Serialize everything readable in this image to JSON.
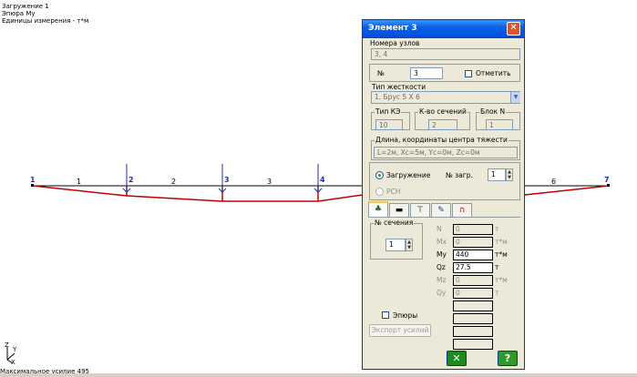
{
  "info": {
    "line1": "Загружение  1",
    "line2": "Эпюра My",
    "line3": "Единицы измерения - т*м"
  },
  "footer": {
    "max_force": "Максимальное усилие  495"
  },
  "axes": {
    "z": "Z",
    "y": "Y",
    "x": "X"
  },
  "model": {
    "node_labels": [
      "1",
      "2",
      "3",
      "4",
      "7"
    ],
    "element_labels": [
      "1",
      "2",
      "3",
      "6"
    ]
  },
  "dialog": {
    "title": "Элемент 3",
    "close": "✕",
    "node_numbers": {
      "label": "Номера узлов",
      "value": "3, 4"
    },
    "number": {
      "label": "№",
      "value": "3",
      "mark_label": "Отметить"
    },
    "stiffness": {
      "label": "Тип жесткости",
      "value": "1. Брус 5 X 6"
    },
    "fe_type": {
      "label": "Тип КЭ",
      "value": "10"
    },
    "sections_count": {
      "label": "К-во сечений",
      "value": "2"
    },
    "block": {
      "label": "Блок N",
      "value": "1"
    },
    "length": {
      "label": "Длина, координаты центра тяжести",
      "value": "L=2м, Xc=5м, Yc=0м, Zc=0м"
    },
    "loading": {
      "radio1": "Загружение",
      "radio2": "РСН",
      "load_no_label": "№ загр.",
      "load_no_value": "1"
    },
    "section": {
      "label": "№ сечения",
      "value": "1"
    },
    "forces": [
      {
        "name": "N",
        "value": "0",
        "unit": "т",
        "active": false
      },
      {
        "name": "Mx",
        "value": "0",
        "unit": "т*м",
        "active": false
      },
      {
        "name": "My",
        "value": "440",
        "unit": "т*м",
        "active": true
      },
      {
        "name": "Qz",
        "value": "27.5",
        "unit": "т",
        "active": true
      },
      {
        "name": "Mz",
        "value": "0",
        "unit": "т*м",
        "active": false
      },
      {
        "name": "Qy",
        "value": "0",
        "unit": "т",
        "active": false
      }
    ],
    "epures_label": "Эпюры",
    "export_label": "Экспорт усилий",
    "ok": "✕",
    "help": "?"
  }
}
